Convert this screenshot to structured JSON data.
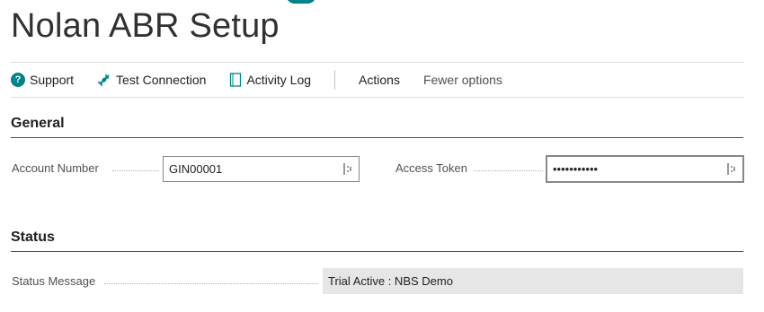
{
  "page": {
    "title": "Nolan ABR Setup",
    "accent_color": "#008489"
  },
  "actions": [
    {
      "label": "Support",
      "icon": "help-icon"
    },
    {
      "label": "Test Connection",
      "icon": "plug-icon"
    },
    {
      "label": "Activity Log",
      "icon": "log-icon"
    }
  ],
  "menu": {
    "actions_label": "Actions",
    "fewer_options_label": "Fewer options"
  },
  "general": {
    "title": "General",
    "account_number": {
      "label": "Account Number",
      "value": "GIN00001"
    },
    "access_token": {
      "label": "Access Token",
      "value": "•••••••••••"
    }
  },
  "status": {
    "title": "Status",
    "status_message": {
      "label": "Status Message",
      "value": "Trial Active : NBS Demo"
    }
  }
}
